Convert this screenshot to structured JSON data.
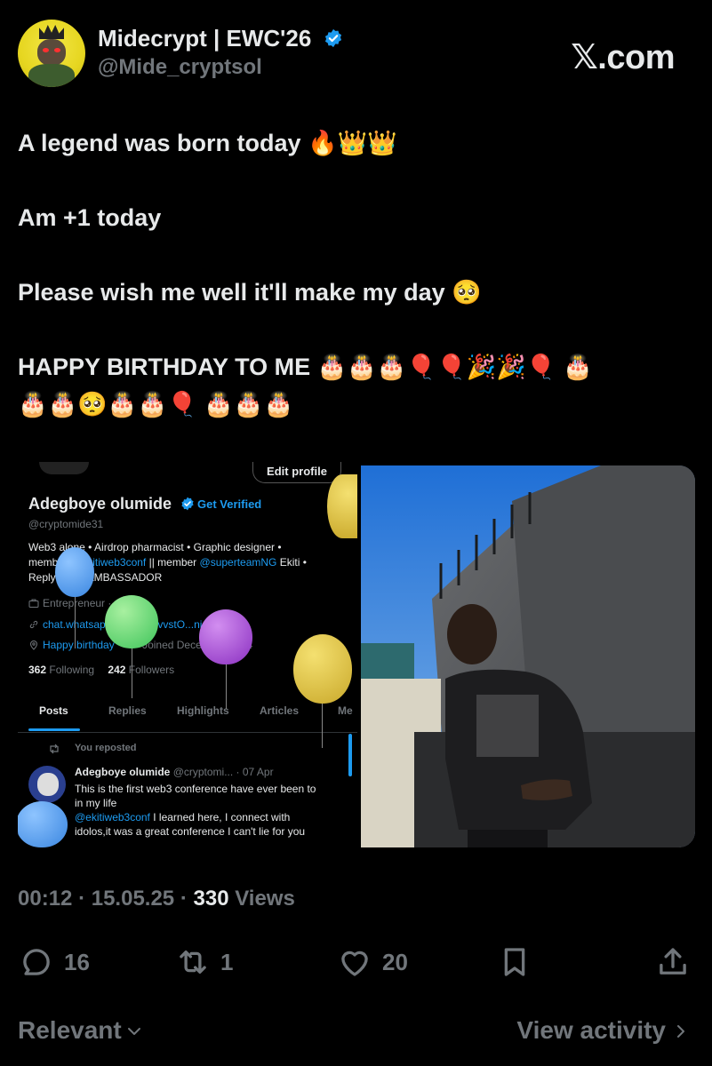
{
  "author": {
    "display_name": "Midecrypt | EWC'26",
    "handle": "@Mide_cryptsol",
    "verified": true
  },
  "brand": {
    "label": "𝕏.com"
  },
  "tweet": {
    "lines": [
      "A legend was born today 🔥👑👑",
      "",
      "Am +1 today",
      "",
      "Please wish me well it'll make my day 🥺",
      "",
      "HAPPY BIRTHDAY TO ME 🎂🎂🎂🎈🎈🎉🎉🎈 🎂",
      "🎂🎂🥺🎂🎂🎈 🎂🎂🎂"
    ]
  },
  "embedded_profile": {
    "edit_button": "Edit profile",
    "name": "Adegboye olumide",
    "get_verified": "Get Verified",
    "handle": "@cryptomide31",
    "bio_line1": "Web3 alone • Airdrop pharmacist • Graphic designer •",
    "bio_member": "member",
    "bio_mention1": "@ekitiweb3conf",
    "bio_mid": "|| member",
    "bio_mention2": "@superteamNG",
    "bio_end": "Ekiti •",
    "bio_line3": "Reply guy || AMBASSADOR",
    "category": "Entrepreneur · web3",
    "link": "chat.whatsapp.com/HnZvvstO...nism",
    "birthday_link": "Happy birthday",
    "joined": "Joined December 2024",
    "following_count": "362",
    "following_label": "Following",
    "followers_count": "242",
    "followers_label": "Followers",
    "tabs": [
      "Posts",
      "Replies",
      "Highlights",
      "Articles",
      "Me"
    ],
    "reposted_label": "You reposted",
    "post_author": "Adegboye olumide",
    "post_meta": "@cryptomi... · 07 Apr",
    "post_text_line1": "This is the first web3 conference have ever been to",
    "post_text_line2": "in my life",
    "post_mention": "@ekitiweb3conf",
    "post_text_line3": "I learned here, I connect with",
    "post_text_line4": "idolos,it was a great conference I can't lie for you"
  },
  "meta": {
    "time": "00:12",
    "date": "15.05.25",
    "views_count": "330",
    "views_label": "Views"
  },
  "actions": {
    "replies": "16",
    "reposts": "1",
    "likes": "20"
  },
  "footer": {
    "relevant": "Relevant",
    "view_activity": "View activity"
  },
  "colors": {
    "background": "#000000",
    "text": "#e7e9ea",
    "muted": "#71767b",
    "accent": "#1d9bf0"
  }
}
